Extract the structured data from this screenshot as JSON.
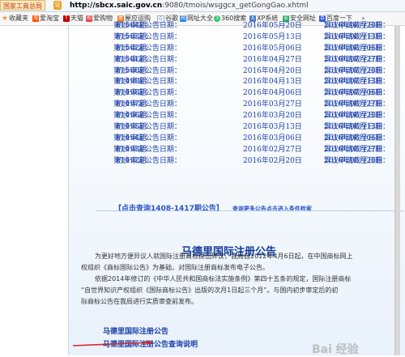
{
  "address_bar": {
    "site_name": "国家工商总局",
    "security_badge": "证",
    "url_domain": "http://sbcx.saic.gov.cn",
    "url_path": ":9080/tmois/wsggcx_getGongGao.xhtml"
  },
  "bookmarks": [
    {
      "label": "收藏夹",
      "icon": "star-icon",
      "color": "#e6a23c"
    },
    {
      "label": "爱淘宝",
      "icon": "taobao-icon",
      "color": "#ff5000"
    },
    {
      "label": "天猫",
      "icon": "tmall-icon",
      "color": "#c40000"
    },
    {
      "label": "爱购物",
      "icon": "shopping-icon",
      "color": "#e04848"
    },
    {
      "label": "屋应运购",
      "icon": "bookmark-icon",
      "color": "#e67e22"
    },
    {
      "label": "谷歌",
      "icon": "google-icon",
      "color": "#3c78d8"
    },
    {
      "label": "网址大全",
      "icon": "sites-icon",
      "color": "#2e86de"
    },
    {
      "label": "360搜索",
      "icon": "360-icon",
      "color": "#2ecc71"
    },
    {
      "label": "XP系统",
      "icon": "xp-icon",
      "color": "#4a7bd0"
    },
    {
      "label": "安全网址",
      "icon": "safe-icon",
      "color": "#27ae60"
    },
    {
      "label": "百度一下",
      "icon": "baidu-icon",
      "color": "#2d5be3"
    }
  ],
  "notices": [
    {
      "period": "第1504期",
      "type": "初步审定公告日期：",
      "date": "2016年05月20日",
      "deadline_label": "异议申请截至日期：",
      "deadline": "2016年08月20日"
    },
    {
      "period": "第1503期",
      "type": "初步审定公告日期：",
      "date": "2016年05月13日",
      "deadline_label": "异议申请截至日期：",
      "deadline": "2016年08月13日"
    },
    {
      "period": "第1502期",
      "type": "初步审定公告日期：",
      "date": "2016年05月06日",
      "deadline_label": "异议申请截至日期：",
      "deadline": "2016年08月06日"
    },
    {
      "period": "第1501期",
      "type": "初步审定公告日期：",
      "date": "2016年04月27日",
      "deadline_label": "异议申请截至日期：",
      "deadline": "2016年07月27日"
    },
    {
      "period": "第1500期",
      "type": "初步审定公告日期：",
      "date": "2016年04月20日",
      "deadline_label": "异议申请截至日期：",
      "deadline": "2016年07月20日"
    },
    {
      "period": "第1499期",
      "type": "初步审定公告日期：",
      "date": "2016年04月13日",
      "deadline_label": "异议申请截至日期：",
      "deadline": "2016年07月13日"
    },
    {
      "period": "第1498期",
      "type": "初步审定公告日期：",
      "date": "2016年04月06日",
      "deadline_label": "异议申请截至日期：",
      "deadline": "2016年07月06日"
    },
    {
      "period": "第1497期",
      "type": "初步审定公告日期：",
      "date": "2016年03月27日",
      "deadline_label": "异议申请截至日期：",
      "deadline": "2016年06月27日"
    },
    {
      "period": "第1496期",
      "type": "初步审定公告日期：",
      "date": "2016年03月20日",
      "deadline_label": "异议申请截至日期：",
      "deadline": "2016年06月20日"
    },
    {
      "period": "第1495期",
      "type": "初步审定公告日期：",
      "date": "2016年03月13日",
      "deadline_label": "异议申请截至日期：",
      "deadline": "2016年06月13日"
    },
    {
      "period": "第1494期",
      "type": "初步审定公告日期：",
      "date": "2016年03月06日",
      "deadline_label": "异议申请截至日期：",
      "deadline": "2016年06月06日"
    },
    {
      "period": "第1493期",
      "type": "初步审定公告日期：",
      "date": "2016年02月27日",
      "deadline_label": "异议申请截至日期：",
      "deadline": "2016年05月27日"
    },
    {
      "period": "第1492期",
      "type": "初步审定公告日期：",
      "date": "2016年02月20日",
      "deadline_label": "异议申请截至日期：",
      "deadline": "2016年05月20日"
    }
  ],
  "query": {
    "range_link": "【点击查询1408-1417期公告】",
    "more_link": "查询更多公告点击进入条件检索"
  },
  "article": {
    "title": "马德里国际注册公告",
    "p1_line1": "为更好地方便异议人就国际注册商标提出异议，我局自2012年4月6日起，在中国商标网上",
    "p1_line2": "权组织《商标国际公告》为基础，对国际注册商标发布电子公告。",
    "p2_line1": "依据2014年修订的《中华人民共和国商标法实施条例》第四十五条的规定，国际注册商标",
    "p2_line2": "“自世界知识产权组织《国际商标公告》出版的次月1日起三个月”。与国内初步审定后的初",
    "p2_line3": "际商标公告在我局进行实质审查前发布。"
  },
  "footer_links": [
    "马德里国际注册公告",
    "马德里国际注册公告查询说明"
  ],
  "watermark": "Bai 经验"
}
